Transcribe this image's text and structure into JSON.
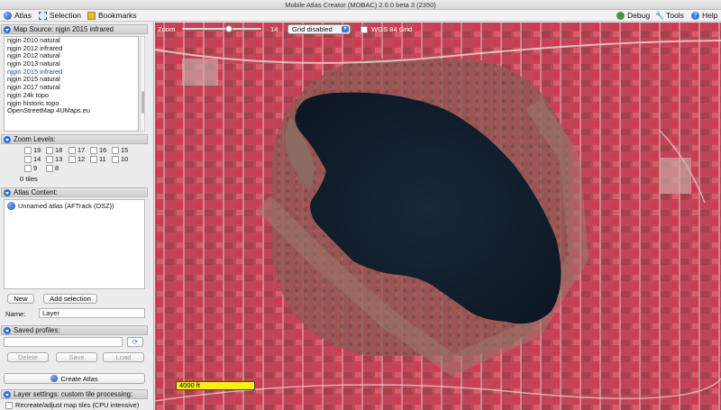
{
  "window": {
    "title": "Mobile Atlas Creator (MOBAC) 2.0.0 beta 3 (2350)"
  },
  "menubar": {
    "atlas": "Atlas",
    "selection": "Selection",
    "bookmarks": "Bookmarks",
    "debug": "Debug",
    "tools": "Tools",
    "help": "Help"
  },
  "map_source": {
    "header": "Map Source: njgin 2015 infrared",
    "items": [
      "njgin 2010 natural",
      "njgin 2012 infrared",
      "njgin 2012 natural",
      "njgin 2013 natural",
      "njgin 2015 infrared",
      "njgin 2015 natural",
      "njgin 2017 natural",
      "njgin 24k topo",
      "njgin historic topo",
      "OpenStreetMap 4UMaps.eu"
    ],
    "selected": "njgin 2015 infrared"
  },
  "zoom_levels": {
    "header": "Zoom Levels:",
    "levels": [
      "19",
      "18",
      "17",
      "16",
      "15",
      "14",
      "13",
      "12",
      "11",
      "10",
      "9",
      "8"
    ],
    "tiles": "0 tiles"
  },
  "atlas_content": {
    "header": "Atlas Content:",
    "item": "Unnamed atlas (AFTrack (OSZ))",
    "new_button": "New",
    "add_selection_button": "Add selection",
    "name_label": "Name:",
    "name_value": "Layer"
  },
  "saved_profiles": {
    "header": "Saved profiles:",
    "delete_button": "Delete",
    "save_button": "Save",
    "load_button": "Load"
  },
  "create_atlas_button": "Create Atlas",
  "layer_settings": {
    "header": "Layer settings: custom tile processing:",
    "option": "Recreate/adjust map tiles (CPU intensive)"
  },
  "map": {
    "zoom_label": "Zoom",
    "zoom_value": "14",
    "grid_select": "Grid disabled",
    "wgs_label": "WGS 84 Grid",
    "scale_label": "4000 ft",
    "colors": {
      "vegetation": "#c9384f",
      "water": "#12202e",
      "ground": "#8a6b5e"
    }
  }
}
